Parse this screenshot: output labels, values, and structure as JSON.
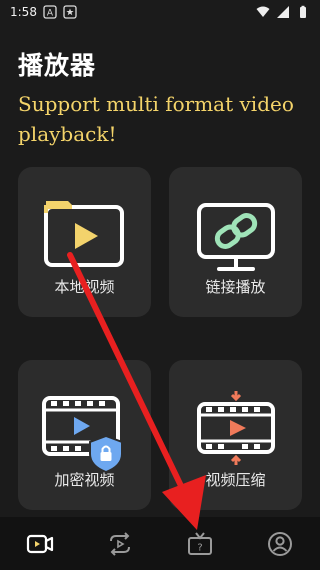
{
  "status_bar": {
    "time": "1:58",
    "left_icons": [
      "font-icon",
      "star-icon"
    ],
    "right_icons": [
      "wifi-icon",
      "signal-icon",
      "battery-icon"
    ]
  },
  "header": {
    "title": "播放器",
    "subtitle": "Support multi format video playback!"
  },
  "cards": [
    {
      "label": "本地视频",
      "icon": "folder-play-icon"
    },
    {
      "label": "链接播放",
      "icon": "monitor-link-icon"
    },
    {
      "label": "加密视频",
      "icon": "film-lock-icon"
    },
    {
      "label": "视频压缩",
      "icon": "film-compress-icon"
    }
  ],
  "bottom_nav": [
    {
      "icon": "video-camera-icon",
      "active": true
    },
    {
      "icon": "convert-video-icon",
      "active": false
    },
    {
      "icon": "tv-help-icon",
      "active": false
    },
    {
      "icon": "profile-icon",
      "active": false
    }
  ],
  "colors": {
    "background": "#1b1b1b",
    "card": "#2c2c2c",
    "subtitle": "#f4d46a",
    "accent_green": "#9fe3b8",
    "accent_orange": "#f07a5a",
    "accent_yellow": "#f3d36c",
    "accent_blue": "#6ea8f0",
    "arrow": "#e82020"
  }
}
